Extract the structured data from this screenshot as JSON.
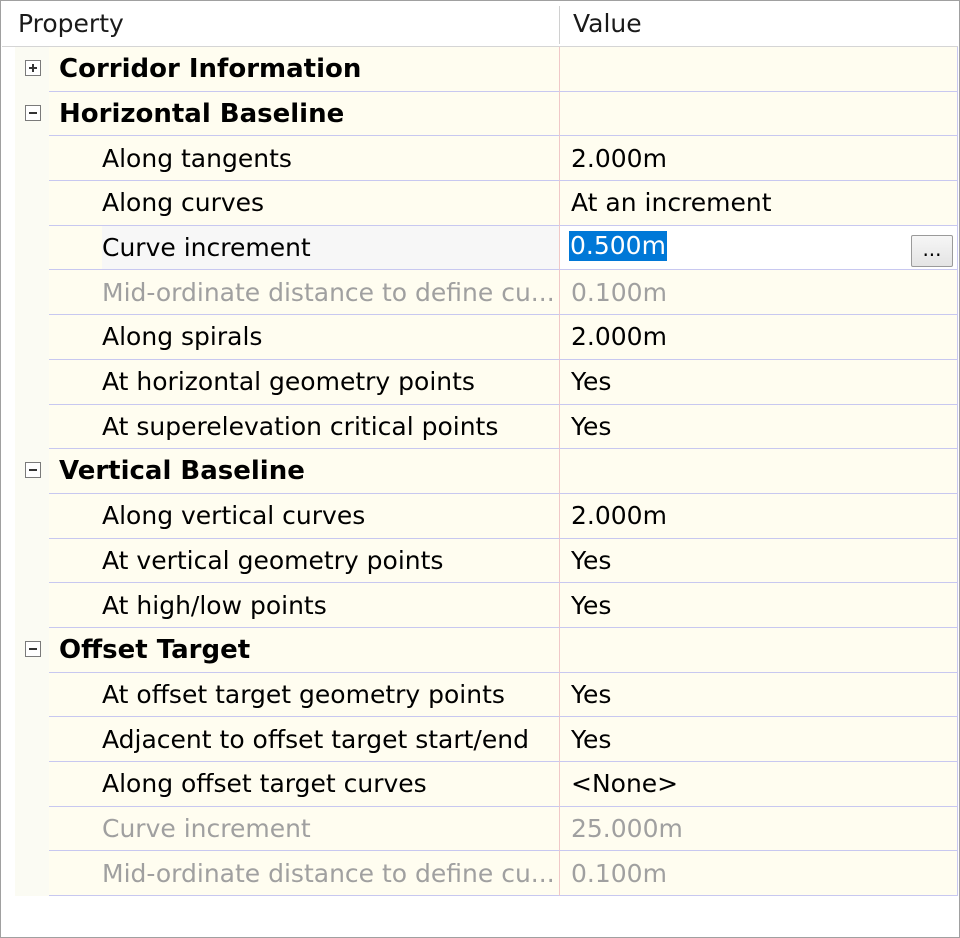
{
  "header": {
    "property": "Property",
    "value": "Value"
  },
  "rows": [
    {
      "kind": "category",
      "label": "Corridor Information",
      "expanded": false
    },
    {
      "kind": "category",
      "label": "Horizontal Baseline",
      "expanded": true
    },
    {
      "kind": "property",
      "label": "Along tangents",
      "value": "2.000m"
    },
    {
      "kind": "property",
      "label": "Along curves",
      "value": "At an increment"
    },
    {
      "kind": "property",
      "label": "Curve increment",
      "value": "0.500m",
      "editing": true,
      "button_label": "..."
    },
    {
      "kind": "property",
      "label": "Mid-ordinate distance to define cu...",
      "value": "0.100m",
      "disabled": true
    },
    {
      "kind": "property",
      "label": "Along spirals",
      "value": "2.000m"
    },
    {
      "kind": "property",
      "label": "At horizontal geometry points",
      "value": "Yes"
    },
    {
      "kind": "property",
      "label": "At superelevation critical points",
      "value": "Yes"
    },
    {
      "kind": "category",
      "label": "Vertical Baseline",
      "expanded": true
    },
    {
      "kind": "property",
      "label": "Along vertical curves",
      "value": "2.000m"
    },
    {
      "kind": "property",
      "label": "At vertical geometry points",
      "value": "Yes"
    },
    {
      "kind": "property",
      "label": "At high/low points",
      "value": "Yes"
    },
    {
      "kind": "category",
      "label": "Offset Target",
      "expanded": true
    },
    {
      "kind": "property",
      "label": "At offset target geometry points",
      "value": "Yes"
    },
    {
      "kind": "property",
      "label": "Adjacent to offset target start/end",
      "value": "Yes"
    },
    {
      "kind": "property",
      "label": "Along offset target curves",
      "value": "<None>"
    },
    {
      "kind": "property",
      "label": "Curve increment",
      "value": "25.000m",
      "disabled": true
    },
    {
      "kind": "property",
      "label": "Mid-ordinate distance to define cu...",
      "value": "0.100m",
      "disabled": true
    }
  ]
}
